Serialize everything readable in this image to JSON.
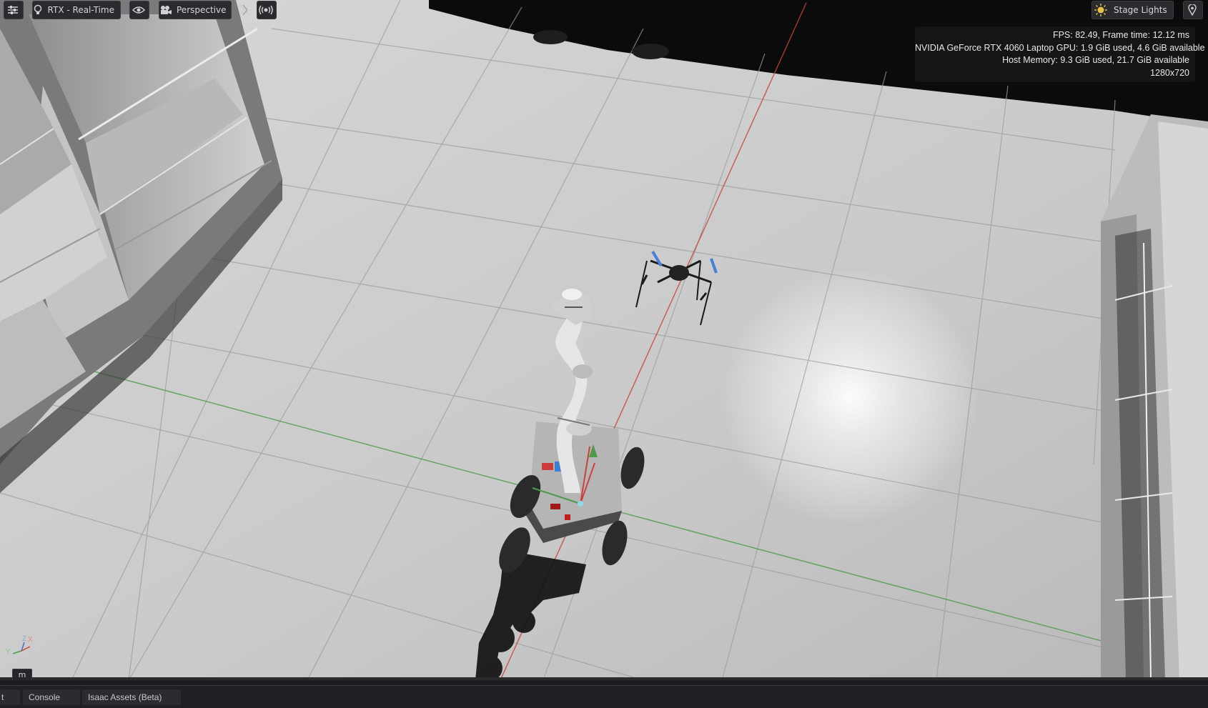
{
  "toolbar": {
    "renderer_label": "RTX - Real-Time",
    "camera_label": "Perspective",
    "lights_label": "Stage Lights"
  },
  "stats": {
    "fps_line": "FPS: 82.49, Frame time: 12.12 ms",
    "gpu_line": "NVIDIA GeForce RTX 4060 Laptop GPU: 1.9 GiB used, 4.6 GiB available",
    "host_line": "Host Memory: 9.3 GiB used, 21.7 GiB available",
    "resolution": "1280x720"
  },
  "viewport": {
    "unit": "m",
    "axes": {
      "z": "Z",
      "x": "X",
      "y": "Y"
    }
  },
  "tabs": [
    {
      "label": "t"
    },
    {
      "label": "Console"
    },
    {
      "label": "Isaac Assets (Beta)"
    }
  ],
  "colors": {
    "axis_x": "#c9423a",
    "axis_y": "#4e9a4a",
    "axis_z": "#4a73c8",
    "toolbar_bg": "#2a2b2e",
    "panel_bg": "#1f2023"
  },
  "icons": {
    "settings": "sliders-icon",
    "renderer": "lightbulb-icon",
    "visibility": "eye-icon",
    "camera": "camera-icon",
    "expand": "chevron-right-icon",
    "broadcast": "broadcast-icon",
    "lights": "sun-icon",
    "pin": "map-pin-icon"
  }
}
